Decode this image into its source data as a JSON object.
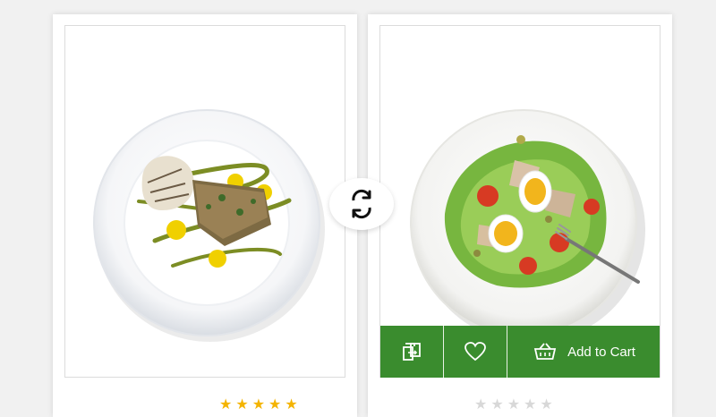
{
  "products": [
    {
      "image_icon": "fish-fillet-plate",
      "rating": 5,
      "max_rating": 5,
      "star_color": "#f4b400"
    },
    {
      "image_icon": "egg-salad-plate",
      "rating": 0,
      "max_rating": 5,
      "star_color": "#d8d8d8",
      "actions": {
        "compare_icon": "compare-icon",
        "wishlist_icon": "heart-icon",
        "cart_icon": "basket-icon",
        "cart_label": "Add to Cart"
      }
    }
  ],
  "swap_icon": "swap-icon",
  "colors": {
    "action_bar": "#3a8c2e",
    "background": "#f1f1f1"
  }
}
